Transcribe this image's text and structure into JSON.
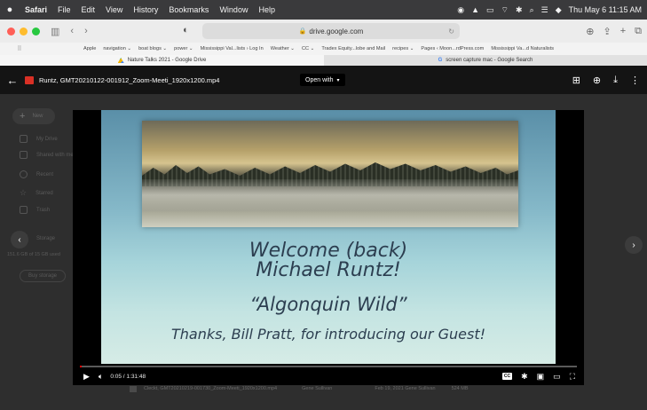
{
  "menubar": {
    "apple": "",
    "items": [
      "Safari",
      "File",
      "Edit",
      "View",
      "History",
      "Bookmarks",
      "Window",
      "Help"
    ],
    "datetime": "Thu May 6  11:15 AM"
  },
  "toolbar": {
    "url": "drive.google.com"
  },
  "bookmarks": [
    "Apple",
    "navigation ⌄",
    "boat blogs ⌄",
    "power ⌄",
    "Mississippi Val...lists › Log In",
    "Weather ⌄",
    "CC ⌄",
    "Tradex Equity...lobe and Mail",
    "recipes ⌄",
    "Pages ‹ Moon...rdPress.com",
    "Mississippi Va...d Naturalists"
  ],
  "tabs": [
    {
      "label": "Nature Talks 2021 - Google Drive",
      "active": true
    },
    {
      "label": "screen capture mac - Google Search",
      "active": false
    }
  ],
  "viewer": {
    "file_name": "Runtz, GMT20210122-001912_Zoom-Meeti_1920x1200.mp4",
    "open_with": "Open with"
  },
  "sidebar": {
    "new": "New",
    "items": [
      "My Drive",
      "Shared with me",
      "Recent",
      "Starred",
      "Trash",
      "Storage"
    ],
    "storage_text": "151.6 GB of 15 GB used",
    "buy_storage": "Buy storage"
  },
  "files": [
    {
      "name": "Cleckt, GMT20210219-001730_Zoom-Meeti_1920x1200.mp4",
      "owner": "Gene Sullivan",
      "modified": "Feb 19, 2021 Gene Sullivan",
      "size": "524 MB"
    }
  ],
  "slide": {
    "line1": "Welcome (back)",
    "line2": "Michael Runtz!",
    "line3": "“Algonquin Wild”",
    "line4": "Thanks, Bill Pratt, for introducing our Guest!"
  },
  "player": {
    "time": "0:05 / 1:31:48",
    "progress_fraction": 0.001,
    "cc_label": "CC"
  },
  "colors": {
    "accent_red": "#ff0000",
    "file_icon": "#d93025",
    "close_red": "#ff5f57",
    "minimize_yellow": "#febc2e",
    "maximize_green": "#28c840"
  }
}
